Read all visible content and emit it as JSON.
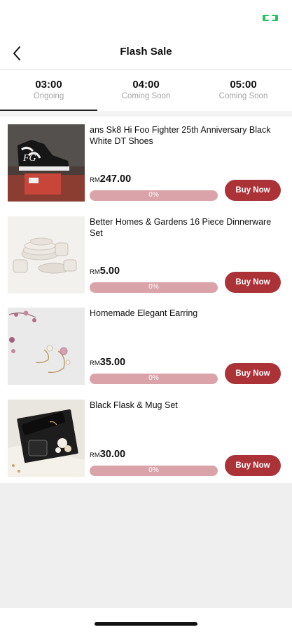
{
  "header": {
    "title": "Flash Sale",
    "back_icon": "chevron-left-icon",
    "status_icon": "battery-icon",
    "status_color": "#22c55e"
  },
  "tabs": [
    {
      "time": "03:00",
      "status": "Ongoing",
      "active": true
    },
    {
      "time": "04:00",
      "status": "Coming Soon",
      "active": false
    },
    {
      "time": "05:00",
      "status": "Coming Soon",
      "active": false
    }
  ],
  "products": [
    {
      "name": "ans Sk8 Hi Foo Fighter 25th Anniversary Black White DT Shoes",
      "currency": "RM",
      "price": "247.00",
      "progress_label": "0%",
      "progress_fraction": 0,
      "button_label": "Buy Now",
      "image_mark_text": "FG"
    },
    {
      "name": "Better Homes & Gardens 16 Piece Dinnerware Set",
      "currency": "RM",
      "price": "5.00",
      "progress_label": "0%",
      "progress_fraction": 0,
      "button_label": "Buy Now"
    },
    {
      "name": "Homemade Elegant Earring",
      "currency": "RM",
      "price": "35.00",
      "progress_label": "0%",
      "progress_fraction": 0,
      "button_label": "Buy Now"
    },
    {
      "name": "Black Flask & Mug Set",
      "currency": "RM",
      "price": "30.00",
      "progress_label": "0%",
      "progress_fraction": 0,
      "button_label": "Buy Now"
    }
  ],
  "colors": {
    "accent": "#ab3338",
    "progress_track": "#d9a3a9",
    "muted_text": "#a5a5a5"
  }
}
